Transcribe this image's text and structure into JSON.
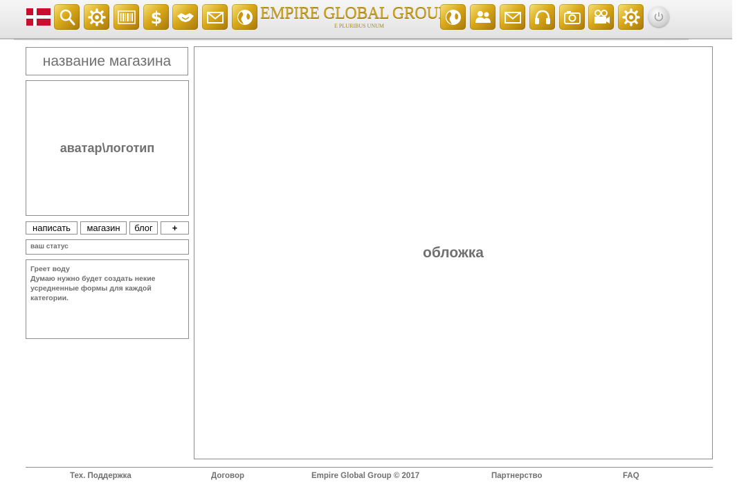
{
  "header": {
    "brand_title": "EMPIRE GLOBAL GROUP",
    "brand_subtitle": "E PLURIBUS UNUM",
    "left_icons": [
      "search-icon",
      "settings-icon",
      "barcode-icon",
      "dollar-icon",
      "handshake-icon",
      "mail-icon",
      "globe-icon"
    ],
    "right_icons": [
      "globe-icon",
      "people-icon",
      "mail-icon",
      "headphones-icon",
      "camera-icon",
      "video-camera-icon",
      "settings-icon"
    ],
    "accent_gold": "#d9a91a",
    "flag_color": "#c8102e"
  },
  "profile": {
    "store_name": "название магазина",
    "avatar_label": "аватар\\логотип",
    "tabs": [
      "написать",
      "магазин",
      "блог",
      "+"
    ],
    "status_placeholder": "ваш статус",
    "post_title": "Греет воду",
    "post_body": "Думаю нужно будет создать некие усредненные формы для каждой категории."
  },
  "main": {
    "cover_label": "обложка"
  },
  "footer": {
    "links": [
      "Тех. Поддержка",
      "Договор",
      "Empire Global Group © 2017",
      "Партнерство",
      "FAQ"
    ]
  }
}
